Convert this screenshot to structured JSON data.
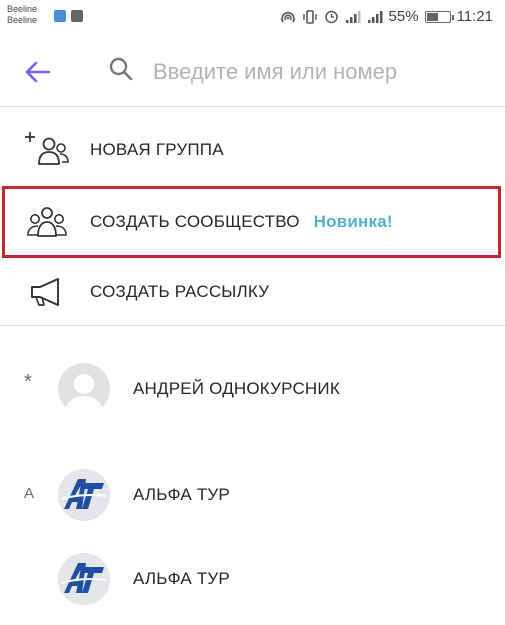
{
  "status_bar": {
    "carrier_1": "Beeline",
    "carrier_2": "Beeline",
    "battery_text": "55%",
    "battery_level": 0.55,
    "time": "11:21"
  },
  "search": {
    "placeholder": "Введите имя или номер",
    "value": ""
  },
  "actions": [
    {
      "label": "НОВАЯ ГРУППА",
      "icon": "add-group-icon",
      "badge": ""
    },
    {
      "label": "СОЗДАТЬ СООБЩЕСТВО",
      "icon": "community-icon",
      "badge": "Новинка!"
    },
    {
      "label": "СОЗДАТЬ РАССЫЛКУ",
      "icon": "megaphone-icon",
      "badge": ""
    }
  ],
  "contacts": [
    {
      "index_letter": "*",
      "name": "АНДРЕЙ ОДНОКУРСНИК",
      "avatar": "default-avatar"
    },
    {
      "index_letter": "A",
      "name": "АЛЬФА ТУР",
      "avatar": "alfa-tour-logo"
    },
    {
      "index_letter": "",
      "name": "АЛЬФА ТУР",
      "avatar": "alfa-tour-logo"
    }
  ],
  "colors": {
    "accent": "#7360f2",
    "badge": "#4fb4c9",
    "highlight": "#c8262e",
    "divider": "#dedede"
  }
}
